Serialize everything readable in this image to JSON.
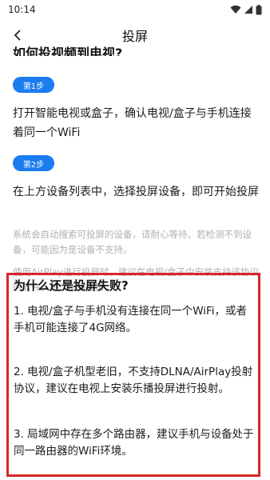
{
  "status": {
    "time": "10:14"
  },
  "app_bar": {
    "title": "投屏",
    "back_icon": "chevron-left-icon"
  },
  "guide": {
    "heading": "如何投视频到电视?",
    "steps": [
      {
        "badge": "第1步",
        "text": "打开智能电视或盒子，确认电视/盒子与手机连接着同一个WiFi"
      },
      {
        "badge": "第2步",
        "text": "在上方设备列表中，选择投屏设备，即可开始投屏"
      }
    ],
    "notes": [
      "系统会自动搜索可投屏的设备，请耐心等待。若检测不到设备，可能因为是设备不支持。",
      "使用AirPlay进行投屏时，建议在电视/盒子中安装支持该协议的软件，如：乐播投屏。"
    ]
  },
  "failure": {
    "title": "为什么还是投屏失败?",
    "items": [
      "1. 电视/盒子与手机没有连接在同一个WiFi，或者手机可能连接了4G网络。",
      "2. 电视/盒子机型老旧，不支持DLNA/AirPlay投射协议，建议在电视上安装乐播投屏进行投射。",
      "3. 局域网中存在多个路由器，建议手机与设备处于同一路由器的WiFi环境。"
    ]
  },
  "colors": {
    "accent": "#1a7cf0",
    "highlight_border": "#d6262a",
    "muted_text": "#b0b0b0"
  }
}
